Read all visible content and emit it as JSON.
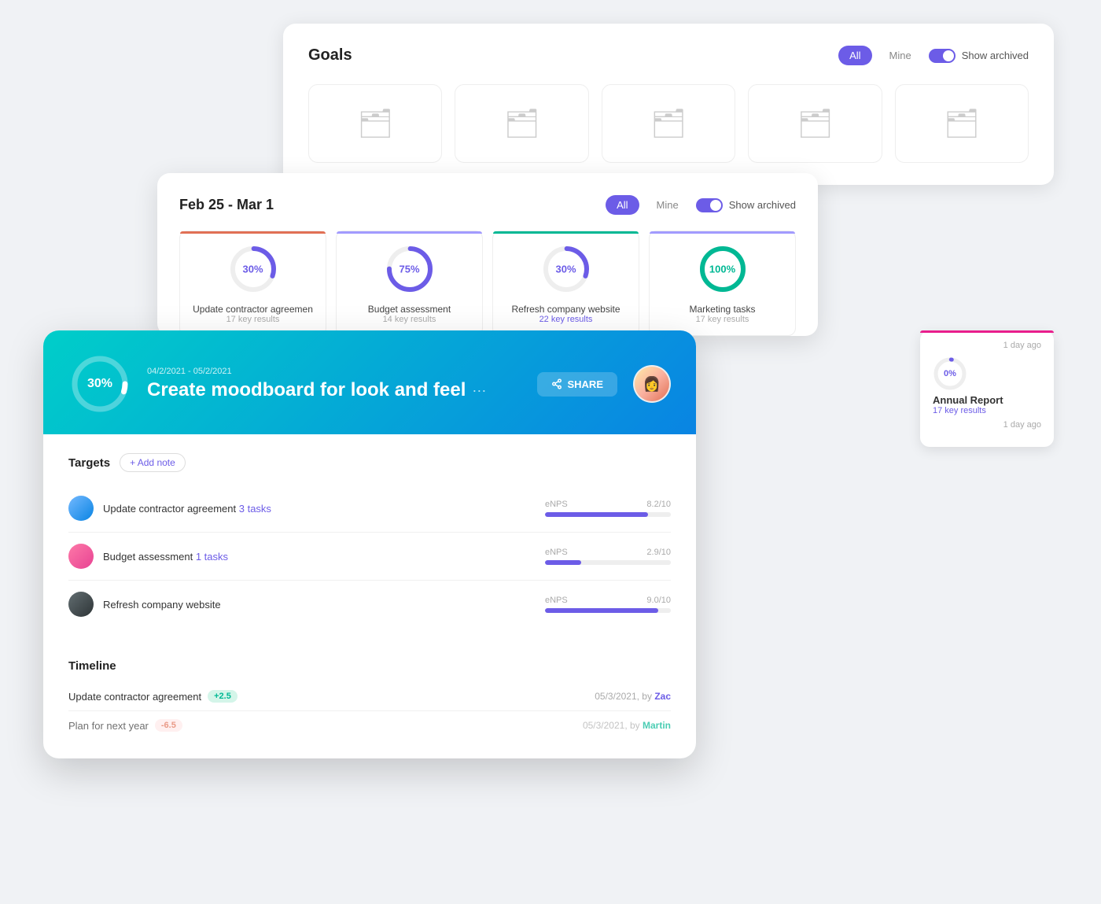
{
  "goals_panel": {
    "title": "Goals",
    "filter": {
      "all_label": "All",
      "mine_label": "Mine",
      "show_archived_label": "Show archived"
    },
    "folders": [
      {
        "id": 1
      },
      {
        "id": 2
      },
      {
        "id": 3
      },
      {
        "id": 4
      },
      {
        "id": 5
      }
    ]
  },
  "weekly_panel": {
    "title": "Feb 25 - Mar 1",
    "filter": {
      "all_label": "All",
      "mine_label": "Mine",
      "show_archived_label": "Show archived"
    },
    "goal_cards": [
      {
        "name": "Update contractor agreemen",
        "sub": "17 key results",
        "percent": 30,
        "color": "#e17055",
        "percent_label": "30%",
        "is_green": false
      },
      {
        "name": "Budget assessment",
        "sub": "14 key results",
        "percent": 75,
        "color": "#6c5ce7",
        "percent_label": "75%",
        "is_green": false
      },
      {
        "name": "Refresh company website",
        "sub": "22 key results",
        "percent": 30,
        "color": "#00b894",
        "percent_label": "30%",
        "is_green": false
      },
      {
        "name": "Marketing tasks",
        "sub": "17 key results",
        "percent": 100,
        "color": "#00b894",
        "percent_label": "100%",
        "is_green": true
      }
    ]
  },
  "right_cards": [
    {
      "meta": "1 day ago",
      "name": "Annual Report",
      "sub": "17 key results",
      "percent": 0,
      "percent_label": "0%",
      "color": "#6c5ce7",
      "top_border": "#e17055"
    }
  ],
  "detail_panel": {
    "date_range": "04/2/2021 - 05/2/2021",
    "title": "Create moodboard for look and feel",
    "progress_percent": 30,
    "progress_label": "30%",
    "share_label": "SHARE",
    "targets_title": "Targets",
    "add_note_label": "+ Add note",
    "targets": [
      {
        "name": "Update contractor agreement",
        "tasks": "3 tasks",
        "metric": "eNPS",
        "value": "8.2/10",
        "fill_percent": 82,
        "avatar_bg": "#74b9ff"
      },
      {
        "name": "Budget assessment",
        "tasks": "1 tasks",
        "metric": "eNPS",
        "value": "2.9/10",
        "fill_percent": 29,
        "avatar_bg": "#fd79a8"
      },
      {
        "name": "Refresh company website",
        "tasks": "",
        "metric": "eNPS",
        "value": "9.0/10",
        "fill_percent": 90,
        "avatar_bg": "#636e72"
      }
    ],
    "timeline_title": "Timeline",
    "timeline_rows": [
      {
        "name": "Update contractor agreement",
        "badge": "+2.5",
        "badge_type": "green",
        "date": "05/3/2021, by ",
        "by_name": "Zac",
        "by_color": "zac"
      },
      {
        "name": "Plan for next year",
        "badge": "-6.5",
        "badge_type": "red",
        "date": "05/3/2021, by ",
        "by_name": "Martin",
        "by_color": "martin"
      }
    ]
  }
}
